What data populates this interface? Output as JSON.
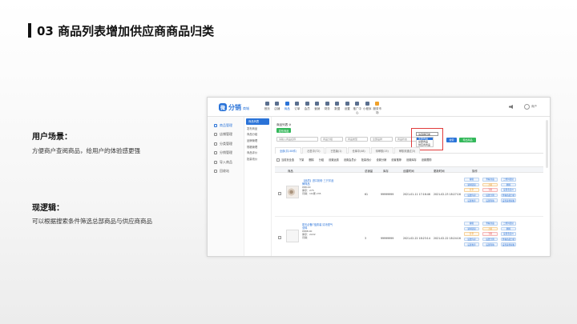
{
  "slide": {
    "title": "03 商品列表增加供应商商品归类",
    "scenario_heading": "用户场景：",
    "scenario_text": "方便商户查阅商品，给用户的体验感更强",
    "logic_heading": "现逻辑：",
    "logic_text": "可以根据搜索条件筛选总部商品与供应商商品"
  },
  "app": {
    "logo_mark": "微",
    "logo_text": "分销",
    "logo_sub": "商城",
    "nav": [
      "首页",
      "店铺",
      "商品",
      "订单",
      "会员",
      "营销",
      "财务",
      "数据",
      "设置",
      "推广中心",
      "小程序",
      "服务市场"
    ],
    "user": "商户"
  },
  "sidebar": [
    "商品管理",
    "店铺管理",
    "分类管理",
    "分销管理",
    "导入商品",
    "回收站"
  ],
  "subsidebar": [
    "商品列表",
    "发布商品",
    "商品分组",
    "品牌管理",
    "规格管理",
    "商品评价",
    "批量改价"
  ],
  "main": {
    "breadcrumb": "商品列表 ⊘",
    "add_button": "发布商品",
    "filters": [
      "请输入商品名称",
      "商品分组",
      "商品类型",
      "全部品牌",
      "商品状态"
    ],
    "source_select": {
      "value": "请选择归类",
      "options": [
        "全部商品",
        "总部商品",
        "供应商商品"
      ],
      "selected_index": 0
    },
    "search_button": "搜索",
    "export_button": "导出商品",
    "tabs": [
      "全部(共180件)",
      "出售中(72)",
      "已售罄(1)",
      "仓库中(48)",
      "待审核(15)",
      "审核未通过(3)"
    ],
    "batch_actions": [
      "当前页全选",
      "下架",
      "删除",
      "分组",
      "设置运费",
      "设置会员价",
      "批量改价",
      "设置分销",
      "设置推荐",
      "设置库存",
      "设置限购"
    ],
    "columns": [
      "商品",
      "总销量",
      "库存",
      "创建时间",
      "更新时间",
      "操作"
    ],
    "rows": [
      {
        "name": "【品质】进口奶粉 三只羊品牌商品",
        "price": "¥88.00",
        "stock_label": "库存：275",
        "sales_label": "月销：10/累 235",
        "sales": "61",
        "stock": "99999999",
        "created": "2021-01-11 17:16:46",
        "updated": "2021-02-23 18:27:16",
        "ops": [
          "编辑",
          "查看商品",
          "二维码链接",
          "复制链接",
          "上架",
          "删除",
          "分享",
          "下架",
          "设置会员价",
          "设置库存",
          "设置分销",
          "查看商品分析",
          "设置推荐",
          "设置限购",
          "设置运费模板"
        ]
      },
      {
        "name": "夏天必备T恤男装 清凉透气 全棉",
        "price": "¥888.00",
        "stock_label": "库存：2222",
        "sales_label": "月销：",
        "sales": "3",
        "stock": "99999999",
        "created": "2021-02-22 18:23:14",
        "updated": "2021-02-22 18:24:16",
        "ops": [
          "编辑",
          "查看商品",
          "二维码链接",
          "复制链接",
          "上架",
          "删除",
          "分享",
          "下架",
          "设置会员价",
          "设置库存",
          "设置分销",
          "查看商品分析",
          "设置推荐",
          "设置限购",
          "设置运费模板"
        ]
      }
    ]
  }
}
